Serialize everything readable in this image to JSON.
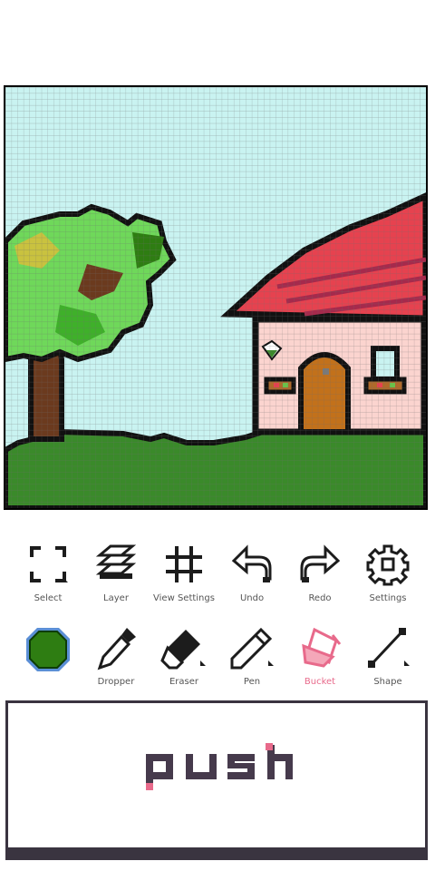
{
  "canvas": {
    "grid_columns": 70,
    "grid_rows": 70,
    "sky_color": "#c9f3f1",
    "grid_line_color": "#6d6d6d"
  },
  "toolbar_top": {
    "items": [
      {
        "label": "Select",
        "icon": "select-icon"
      },
      {
        "label": "Layer",
        "icon": "layer-icon"
      },
      {
        "label": "View Settings",
        "icon": "grid-icon"
      },
      {
        "label": "Undo",
        "icon": "undo-icon"
      },
      {
        "label": "Redo",
        "icon": "redo-icon"
      },
      {
        "label": "Settings",
        "icon": "gear-icon"
      }
    ]
  },
  "toolbar_bottom": {
    "current_color": "#2e7d12",
    "items": [
      {
        "label": "Dropper",
        "icon": "dropper-icon"
      },
      {
        "label": "Eraser",
        "icon": "eraser-icon"
      },
      {
        "label": "Pen",
        "icon": "pen-icon"
      },
      {
        "label": "Bucket",
        "icon": "bucket-icon",
        "active": true
      },
      {
        "label": "Shape",
        "icon": "line-shape-icon"
      }
    ],
    "active_color": "#e86a8b"
  },
  "banner": {
    "logo_text": "push"
  }
}
